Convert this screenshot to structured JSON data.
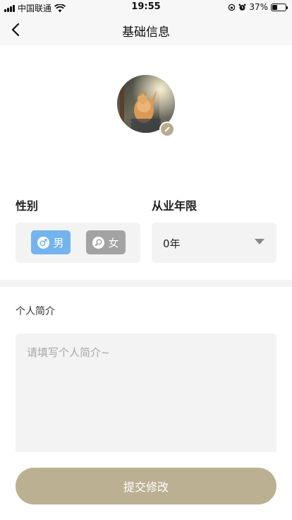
{
  "status_bar": {
    "carrier": "中国联通",
    "time": "19:55",
    "battery": "37%"
  },
  "nav": {
    "title": "基础信息",
    "back_icon": "chevron-left-icon"
  },
  "avatar": {
    "edit_icon": "pencil-icon"
  },
  "gender": {
    "label": "性别",
    "male": "男",
    "female": "女",
    "selected": "男"
  },
  "experience": {
    "label": "从业年限",
    "value": "0年"
  },
  "intro": {
    "label": "个人简介",
    "placeholder": "请填写个人简介~",
    "value": ""
  },
  "submit_label": "提交修改",
  "colors": {
    "accent": "#bcb093",
    "male_selected": "#74b4ee",
    "female_unselected": "#a3a3a3",
    "field_bg": "#f3f3f3"
  }
}
